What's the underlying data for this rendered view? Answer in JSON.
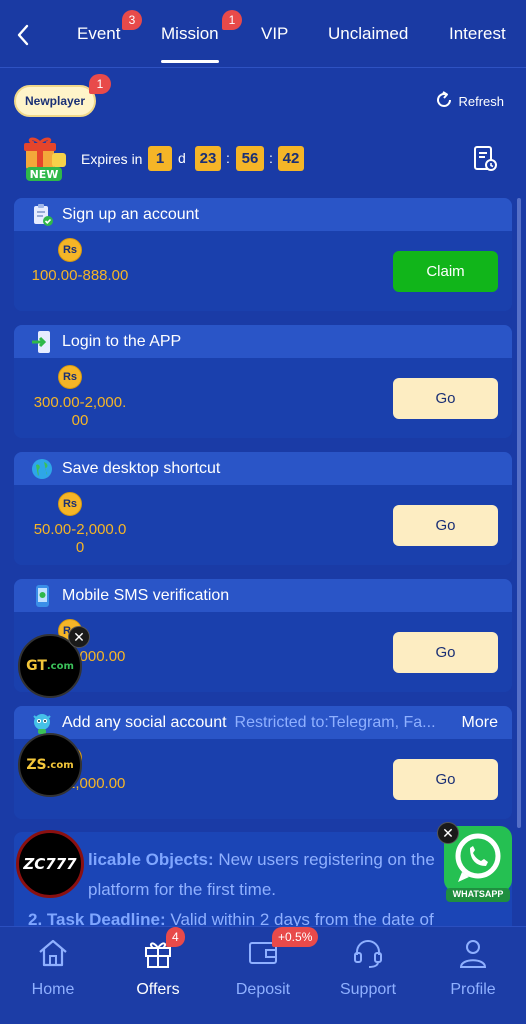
{
  "tabs": [
    {
      "label": "Event",
      "badge": "3"
    },
    {
      "label": "Mission",
      "badge": "1"
    },
    {
      "label": "VIP"
    },
    {
      "label": "Unclaimed"
    },
    {
      "label": "Interest"
    }
  ],
  "filter": {
    "label": "Newplayer",
    "badge": "1",
    "refresh_label": "Refresh"
  },
  "countdown": {
    "new_label": "NEW",
    "expires_label": "Expires in",
    "days": "1",
    "days_unit": "d",
    "hours": "23",
    "minutes": "56",
    "seconds": "42"
  },
  "tasks": [
    {
      "title": "Sign up an account",
      "currency": "Rs",
      "amount": "100.00-888.00",
      "action": "Claim",
      "icon": "clipboard-check-icon"
    },
    {
      "title": "Login to the APP",
      "currency": "Rs",
      "amount": "300.00-2,000.00",
      "action": "Go",
      "icon": "phone-login-icon"
    },
    {
      "title": "Save desktop shortcut",
      "currency": "Rs",
      "amount": "50.00-2,000.00",
      "action": "Go",
      "icon": "globe-icon"
    },
    {
      "title": "Mobile SMS verification",
      "currency": "Rs",
      "amount": "-2,000.00",
      "action": "Go",
      "icon": "sms-phone-icon"
    },
    {
      "title": "Add any social account",
      "restricted": "Restricted to:Telegram, Fa...",
      "more": "More",
      "currency": "Rs",
      "amount": "-2,000.00",
      "action": "Go",
      "icon": "social-mascot-icon"
    }
  ],
  "rules": [
    {
      "label": "licable Objects:",
      "text": " New users registering on the"
    },
    {
      "label": "",
      "text": "platform for the first time."
    },
    {
      "label": "2. Task Deadline:",
      "text": " Valid within 2 days from the date of"
    }
  ],
  "floating_ads": [
    {
      "label": "GT"
    },
    {
      "label": "ZS"
    },
    {
      "label": "ZC777"
    },
    {
      "label": "WHATSAPP"
    }
  ],
  "bottom_nav": [
    {
      "label": "Home",
      "icon": "home-icon"
    },
    {
      "label": "Offers",
      "icon": "gift-icon",
      "badge": "4"
    },
    {
      "label": "Deposit",
      "icon": "wallet-icon",
      "badge": "+0.5%"
    },
    {
      "label": "Support",
      "icon": "headset-icon"
    },
    {
      "label": "Profile",
      "icon": "user-icon"
    }
  ],
  "colors": {
    "background": "#1a3ba6",
    "accent": "#f5b527",
    "claim": "#11b51a",
    "go": "#fdedc2",
    "badge": "#e84a4a"
  }
}
